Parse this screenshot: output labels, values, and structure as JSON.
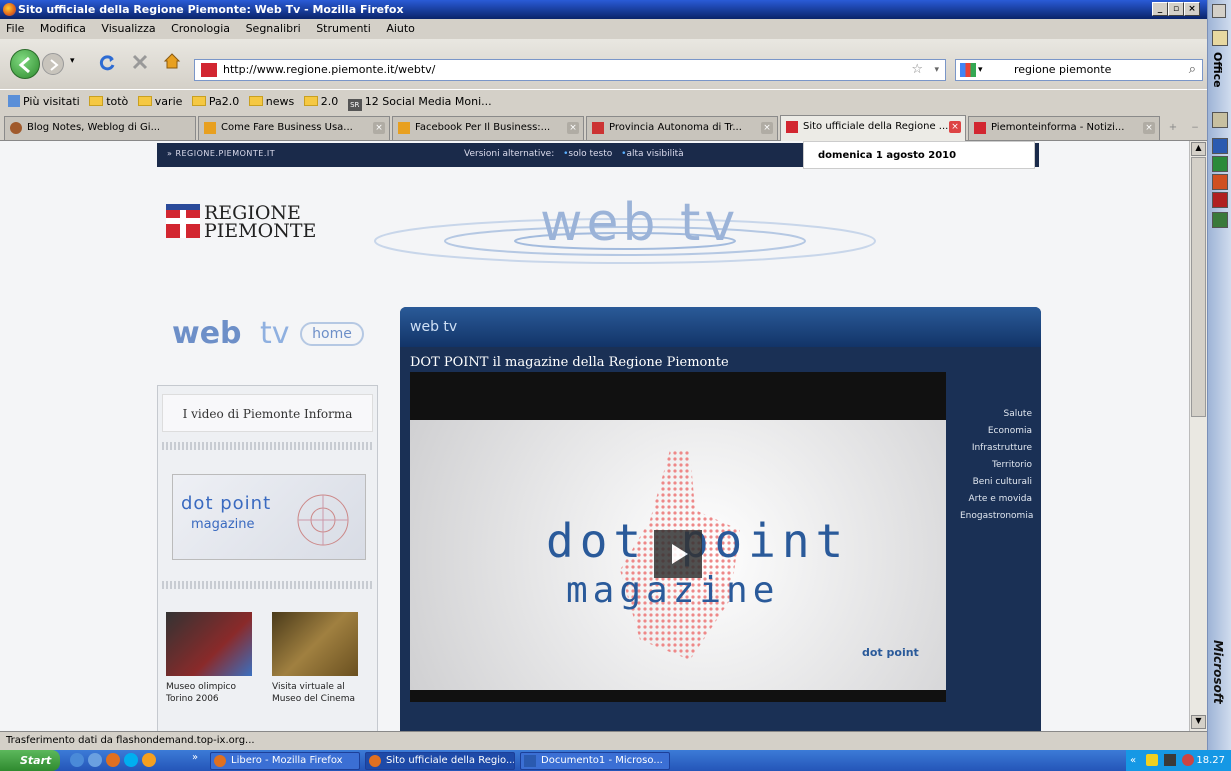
{
  "window": {
    "title": "Sito ufficiale della Regione Piemonte: Web Tv - Mozilla Firefox"
  },
  "menu": [
    "File",
    "Modifica",
    "Visualizza",
    "Cronologia",
    "Segnalibri",
    "Strumenti",
    "Aiuto"
  ],
  "nav": {
    "url": "http://www.regione.piemonte.it/webtv/",
    "search": "regione piemonte"
  },
  "bookmarks": [
    {
      "label": "Più visitati",
      "icon": "page-icon"
    },
    {
      "label": "totò",
      "icon": "folder-icon"
    },
    {
      "label": "varie",
      "icon": "folder-icon"
    },
    {
      "label": "Pa2.0",
      "icon": "folder-icon"
    },
    {
      "label": "news",
      "icon": "folder-icon"
    },
    {
      "label": "2.0",
      "icon": "folder-icon"
    },
    {
      "label": "12 Social Media Moni...",
      "icon": "sr-icon"
    }
  ],
  "tabs": [
    "Blog Notes, Weblog di Gi...",
    "Come Fare Business Usa...",
    "Facebook Per Il Business:...",
    "Provincia Autonoma di Tr...",
    "Sito ufficiale della Regione ...",
    "Piemonteinforma - Notizi..."
  ],
  "page": {
    "topstrip_logo": "REGIONE.PIEMONTE.IT",
    "versions_label": "Versioni alternative:",
    "version_text": "solo testo",
    "version_contrast": "alta visibilità",
    "date": "domenica 1 agosto 2010",
    "regione_line1": "REGIONE",
    "regione_line2": "PIEMONTE",
    "webtv_logo": "web tv",
    "home_web": "web",
    "home_tv": "tv",
    "home_label": "home",
    "sidebar_title": "I video di Piemonte Informa",
    "dot_line1": "dot point",
    "dot_line2": "magazine",
    "videos": [
      {
        "line1": "Museo olimpico",
        "line2": "Torino 2006"
      },
      {
        "line1": "Visita virtuale al",
        "line2": "Museo del Cinema"
      }
    ],
    "player_header": "web tv",
    "player_subtitle": "DOT POINT il magazine della Regione Piemonte",
    "video_dot": "dot point",
    "video_magazine": "magazine",
    "video_logo": "dot point",
    "categories": [
      "Salute",
      "Economia",
      "Infrastrutture",
      "Territorio",
      "Beni culturali",
      "Arte e movida",
      "Enogastronomia"
    ]
  },
  "status": "Trasferimento dati da flashondemand.top-ix.org...",
  "taskbar": {
    "start": "Start",
    "tasks": [
      "Libero - Mozilla Firefox",
      "Sito ufficiale della Regio...",
      "Documento1 - Microso..."
    ],
    "clock": "18.27"
  },
  "officebar": {
    "title": "Office",
    "brand": "Microsoft"
  },
  "colors": {
    "titlebar": "#0a246a",
    "accent": "#2a5a98",
    "regione_red": "#d22630"
  }
}
